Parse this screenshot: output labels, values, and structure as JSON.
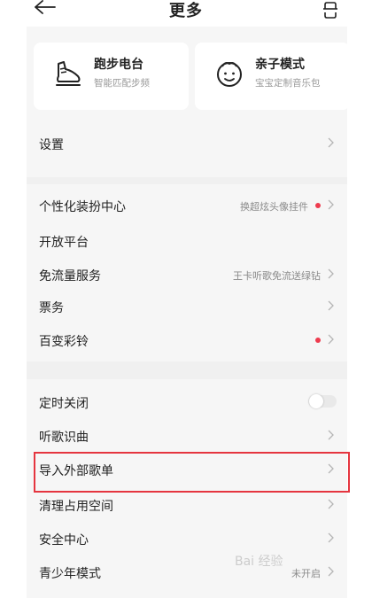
{
  "header": {
    "title": "更多"
  },
  "cards": [
    {
      "title": "跑步电台",
      "subtitle": "智能匹配步频",
      "icon": "running-shoe-icon"
    },
    {
      "title": "亲子模式",
      "subtitle": "宝宝定制音乐包",
      "icon": "baby-face-icon"
    }
  ],
  "rows": {
    "settings": {
      "label": "设置"
    },
    "personalize": {
      "label": "个性化装扮中心",
      "value": "换超炫头像挂件"
    },
    "open_platform": {
      "label": "开放平台"
    },
    "free_data": {
      "label": "免流量服务",
      "value": "王卡听歌免流送绿钻"
    },
    "tickets": {
      "label": "票务"
    },
    "ringtone": {
      "label": "百变彩铃"
    },
    "timer_off": {
      "label": "定时关闭"
    },
    "song_recognition": {
      "label": "听歌识曲"
    },
    "import_playlist": {
      "label": "导入外部歌单"
    },
    "clean_space": {
      "label": "清理占用空间"
    },
    "security": {
      "label": "安全中心"
    },
    "teen_mode": {
      "label": "青少年模式",
      "value": "未开启"
    }
  },
  "colors": {
    "accent_red": "#ee3b4e",
    "highlight_red": "#e5353f"
  },
  "watermark": "Bai 经验"
}
